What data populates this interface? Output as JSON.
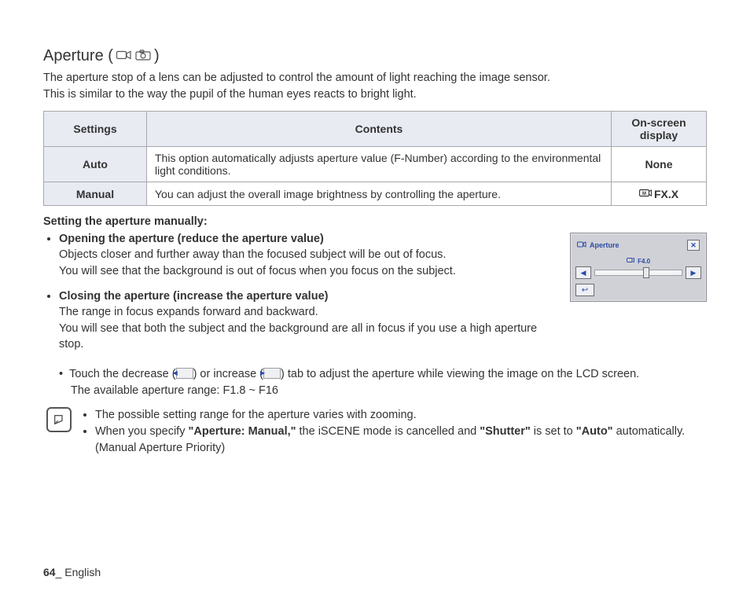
{
  "title": "Aperture (",
  "title_end": ")",
  "intro_line1": "The aperture stop of a lens can be adjusted to control the amount of light reaching the image sensor.",
  "intro_line2": "This is similar to the way the pupil of the human eyes reacts to bright light.",
  "table": {
    "headers": {
      "settings": "Settings",
      "contents": "Contents",
      "display": "On-screen display"
    },
    "rows": [
      {
        "setting": "Auto",
        "contents": "This option automatically adjusts aperture value (F-Number) according to the environmental light conditions.",
        "display": "None"
      },
      {
        "setting": "Manual",
        "contents": "You can adjust the overall image brightness by controlling the aperture.",
        "display": "FX.X"
      }
    ]
  },
  "manual_heading": "Setting the aperture manually:",
  "bullets": [
    {
      "title": "Opening the aperture (reduce the aperture value)",
      "body": "Objects closer and further away than the focused subject will be out of focus.\nYou will see that the background is out of focus when you focus on the subject."
    },
    {
      "title": "Closing the aperture (increase the aperture value)",
      "body": "The range in focus expands forward and backward.\nYou will see that both the subject and the background are all in focus if you use a high aperture stop."
    }
  ],
  "touch": {
    "pre": "Touch the decrease (",
    "mid": ") or increase (",
    "post": ") tab to adjust the aperture while viewing the image on the LCD screen.",
    "range": "The available aperture range: F1.8 ~ F16"
  },
  "notes": [
    "The possible setting range for the aperture varies with zooming.",
    {
      "pre": "When you specify ",
      "b1": "\"Aperture: Manual,\"",
      "mid": " the iSCENE mode is cancelled and ",
      "b2": "\"Shutter\"",
      "mid2": " is set to ",
      "b3": "\"Auto\"",
      "post": " automatically. (Manual Aperture Priority)"
    }
  ],
  "osd": {
    "title": "Aperture",
    "readout": "F4.0"
  },
  "footer": {
    "page": "64",
    "sep": "_ ",
    "lang": "English"
  }
}
